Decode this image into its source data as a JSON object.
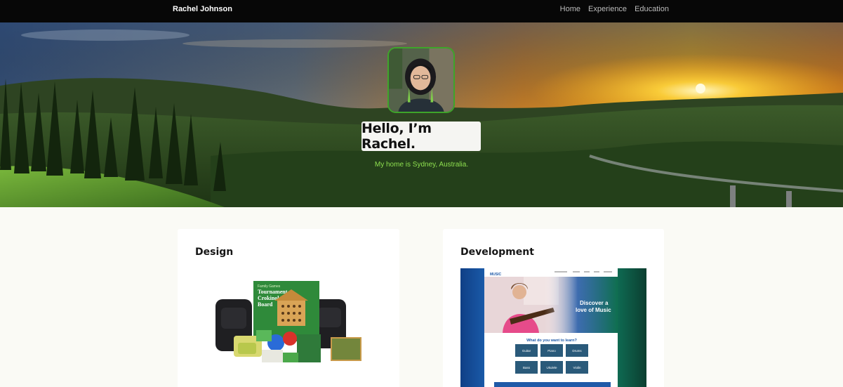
{
  "nav": {
    "brand": "Rachel Johnson",
    "links": [
      "Home",
      "Experience",
      "Education"
    ]
  },
  "hero": {
    "greeting": "Hello, I’m Rachel.",
    "subtitle": "My home is Sydney, Australia.",
    "colors": {
      "subtitle": "#8ee04f",
      "avatar_border": "#3ea52a"
    }
  },
  "sections": [
    {
      "title": "Design",
      "image": {
        "box_lines": [
          "Family Games",
          "Tournament",
          "Crokinole",
          "Board"
        ]
      }
    },
    {
      "title": "Development",
      "image": {
        "logo": "MUSIC",
        "headline": [
          "Discover a",
          "love of Music"
        ],
        "question": "What do you want to learn?",
        "instruments": [
          "Guitar",
          "Piano",
          "Drums",
          "Bass",
          "Ukulele",
          "Violin"
        ]
      }
    }
  ]
}
